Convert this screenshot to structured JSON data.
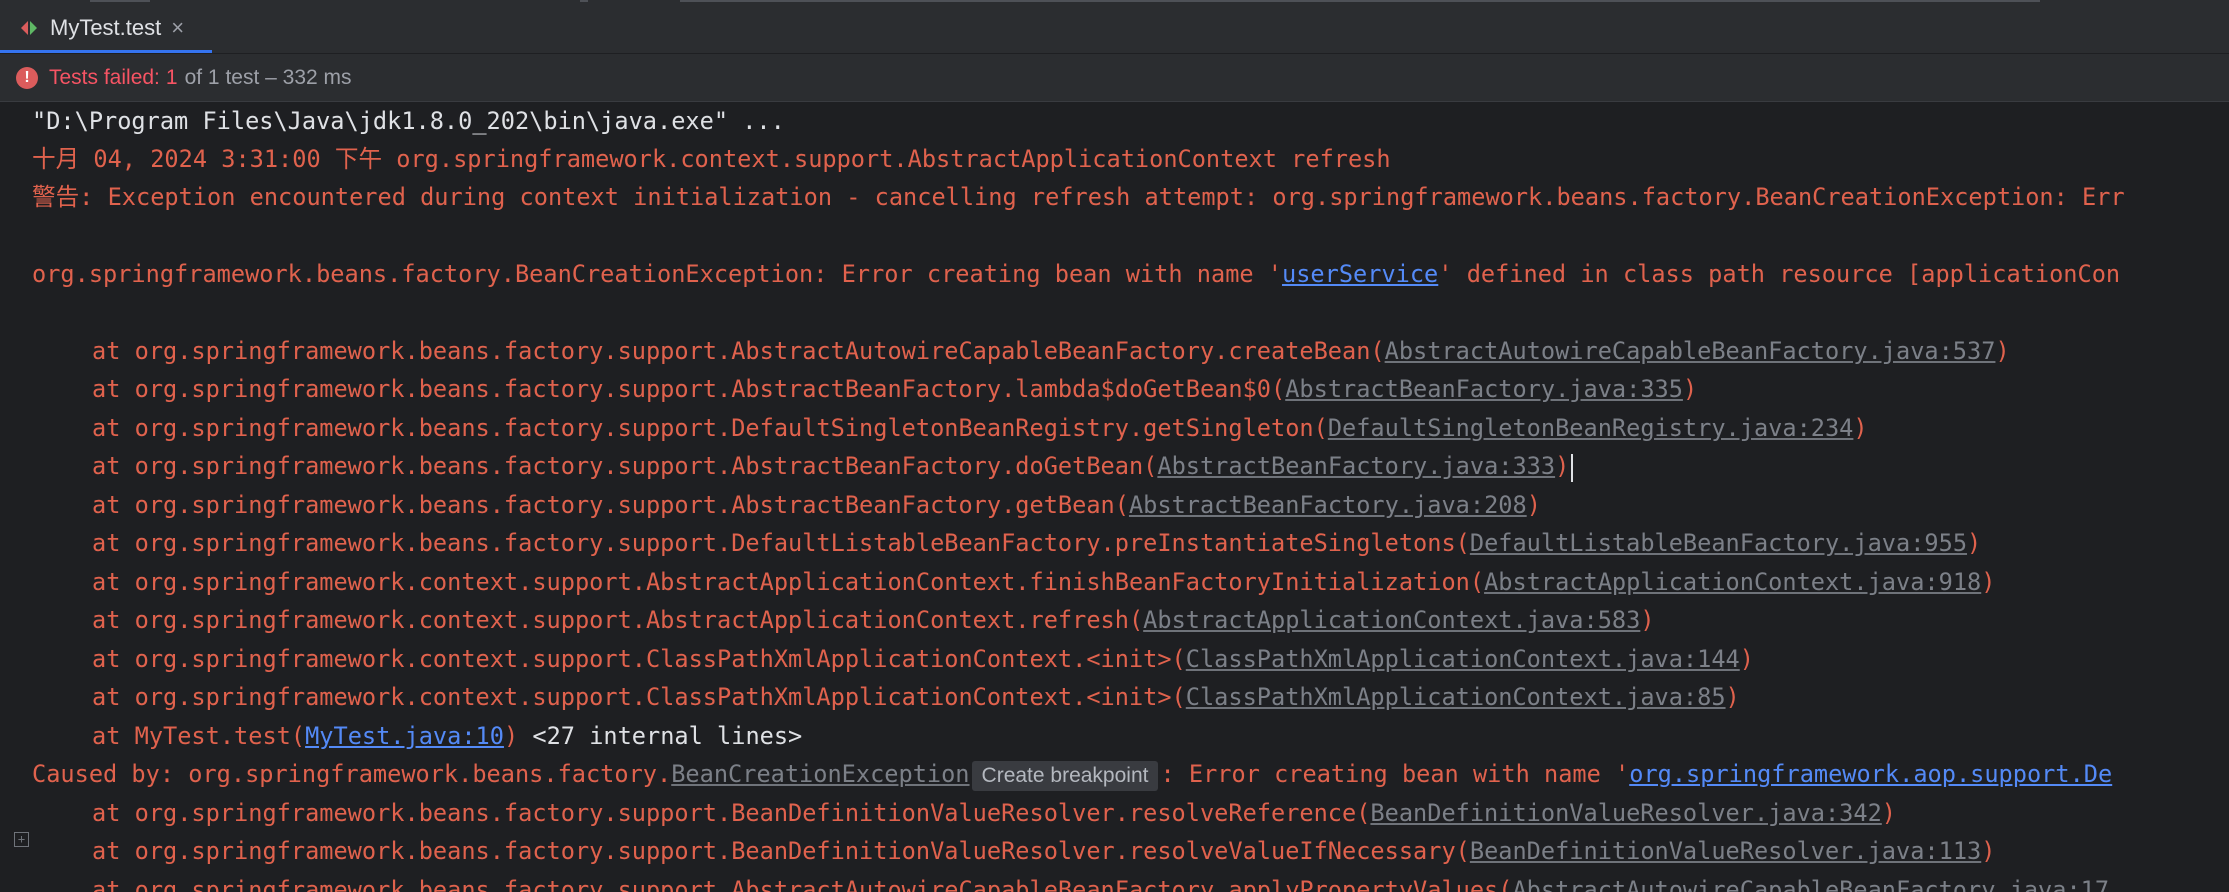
{
  "tab": {
    "icon": "test-run-icon",
    "label": "MyTest.test",
    "close": "×"
  },
  "status": {
    "icon": "error-icon",
    "label": "Tests failed:",
    "count": "1",
    "rest": "of 1 test – 332 ms"
  },
  "console": {
    "l1": "\"D:\\Program Files\\Java\\jdk1.8.0_202\\bin\\java.exe\" ...",
    "l2": "十月 04, 2024 3:31:00 下午 org.springframework.context.support.AbstractApplicationContext refresh",
    "l3": "警告: Exception encountered during context initialization - cancelling refresh attempt: org.springframework.beans.factory.BeanCreationException: Err",
    "l4_pre": "org.springframework.beans.factory.BeanCreationException: Error creating bean with name '",
    "l4_link": "userService",
    "l4_post": "' defined in class path resource [applicationCon",
    "frames": [
      {
        "pre": "at org.springframework.beans.factory.support.AbstractAutowireCapableBeanFactory.createBean(",
        "link": "AbstractAutowireCapableBeanFactory.java:537",
        "post": ")"
      },
      {
        "pre": "at org.springframework.beans.factory.support.AbstractBeanFactory.lambda$doGetBean$0(",
        "link": "AbstractBeanFactory.java:335",
        "post": ")"
      },
      {
        "pre": "at org.springframework.beans.factory.support.DefaultSingletonBeanRegistry.getSingleton(",
        "link": "DefaultSingletonBeanRegistry.java:234",
        "post": ")"
      },
      {
        "pre": "at org.springframework.beans.factory.support.AbstractBeanFactory.doGetBean(",
        "link": "AbstractBeanFactory.java:333",
        "post": ")"
      },
      {
        "pre": "at org.springframework.beans.factory.support.AbstractBeanFactory.getBean(",
        "link": "AbstractBeanFactory.java:208",
        "post": ")"
      },
      {
        "pre": "at org.springframework.beans.factory.support.DefaultListableBeanFactory.preInstantiateSingletons(",
        "link": "DefaultListableBeanFactory.java:955",
        "post": ")"
      },
      {
        "pre": "at org.springframework.context.support.AbstractApplicationContext.finishBeanFactoryInitialization(",
        "link": "AbstractApplicationContext.java:918",
        "post": ")"
      },
      {
        "pre": "at org.springframework.context.support.AbstractApplicationContext.refresh(",
        "link": "AbstractApplicationContext.java:583",
        "post": ")"
      },
      {
        "pre": "at org.springframework.context.support.ClassPathXmlApplicationContext.<init>(",
        "link": "ClassPathXmlApplicationContext.java:144",
        "post": ")"
      },
      {
        "pre": "at org.springframework.context.support.ClassPathXmlApplicationContext.<init>(",
        "link": "ClassPathXmlApplicationContext.java:85",
        "post": ")"
      }
    ],
    "mytest_pre": "at MyTest.test(",
    "mytest_link": "MyTest.java:10",
    "mytest_post": ")",
    "internal_lines": " <27 internal lines>",
    "fold_icon": "+",
    "caused_pre": "Caused by: org.springframework.beans.factory.",
    "caused_link": "BeanCreationException",
    "tooltip": "Create breakpoint",
    "caused_mid": ": Error creating bean with name '",
    "caused_link2": "org.springframework.aop.support.De",
    "frames2": [
      {
        "pre": "at org.springframework.beans.factory.support.BeanDefinitionValueResolver.resolveReference(",
        "link": "BeanDefinitionValueResolver.java:342",
        "post": ")"
      },
      {
        "pre": "at org.springframework.beans.factory.support.BeanDefinitionValueResolver.resolveValueIfNecessary(",
        "link": "BeanDefinitionValueResolver.java:113",
        "post": ")"
      },
      {
        "pre": "at org.springframework.beans.factory.support.AbstractAutowireCapableBeanFactory.applyPropertyValues(",
        "link": "AbstractAutowireCapableBeanFactory.java:17",
        "post": ""
      }
    ]
  }
}
